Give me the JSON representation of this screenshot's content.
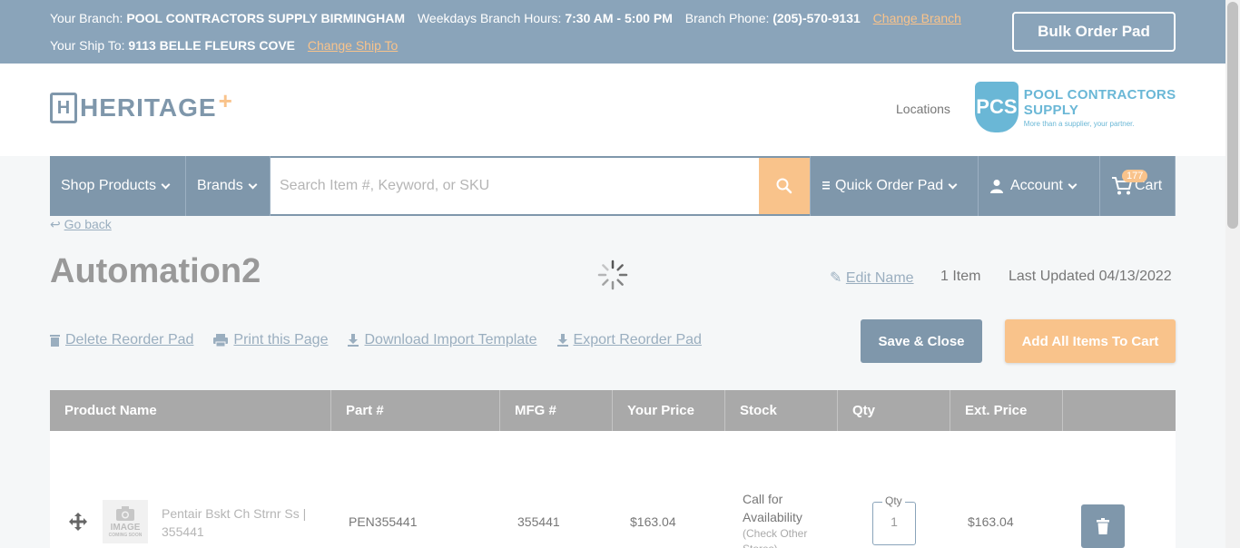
{
  "topbar": {
    "branch_label": "Your Branch:",
    "branch_name": "POOL CONTRACTORS SUPPLY BIRMINGHAM",
    "hours_label": "Weekdays Branch Hours:",
    "hours": "7:30 AM - 5:00 PM",
    "phone_label": "Branch Phone:",
    "phone": "(205)-570-9131",
    "change_branch": "Change Branch",
    "shipto_label": "Your Ship To:",
    "shipto": "9113 BELLE FLEURS COVE",
    "change_shipto": "Change Ship To",
    "bulk_order_pad": "Bulk Order Pad"
  },
  "header": {
    "logo_letter": "H",
    "logo_text": "HERITAGE",
    "logo_plus": "+",
    "locations": "Locations",
    "pcs_badge": "PCS",
    "pcs_name": "POOL CONTRACTORS SUPPLY",
    "pcs_tagline": "More than a supplier, your partner."
  },
  "nav": {
    "shop_products": "Shop Products",
    "brands": "Brands",
    "search_placeholder": "Search Item #, Keyword, or SKU",
    "quick_order_pad": "Quick Order Pad",
    "account": "Account",
    "cart": "Cart",
    "cart_count": "177"
  },
  "page": {
    "go_back": "Go back",
    "title": "Automation2",
    "edit_name": "Edit Name",
    "item_count": "1 Item",
    "last_updated": "Last Updated 04/13/2022",
    "actions": {
      "delete": "Delete Reorder Pad",
      "print": "Print this Page",
      "download": "Download Import Template",
      "export": "Export Reorder Pad"
    },
    "save_close": "Save & Close",
    "add_all": "Add All Items To Cart"
  },
  "table": {
    "headers": [
      "Product Name",
      "Part #",
      "MFG #",
      "Your Price",
      "Stock",
      "Qty",
      "Ext. Price"
    ],
    "rows": [
      {
        "image_caption": "IMAGE",
        "image_caption2": "COMING SOON",
        "name": "Pentair Bskt Ch Strnr Ss | 355441",
        "part": "PEN355441",
        "mfg": "355441",
        "price": "$163.04",
        "stock": "Call for Availability",
        "stock_sub": "(Check Other Stores)",
        "qty_label": "Qty",
        "qty": "1",
        "ext_price": "$163.04"
      }
    ]
  },
  "colors": {
    "slate": "#7f97ab",
    "topbar": "#8aa4ba",
    "accent_orange": "#f9c38b",
    "table_header": "#a9a9a9"
  }
}
